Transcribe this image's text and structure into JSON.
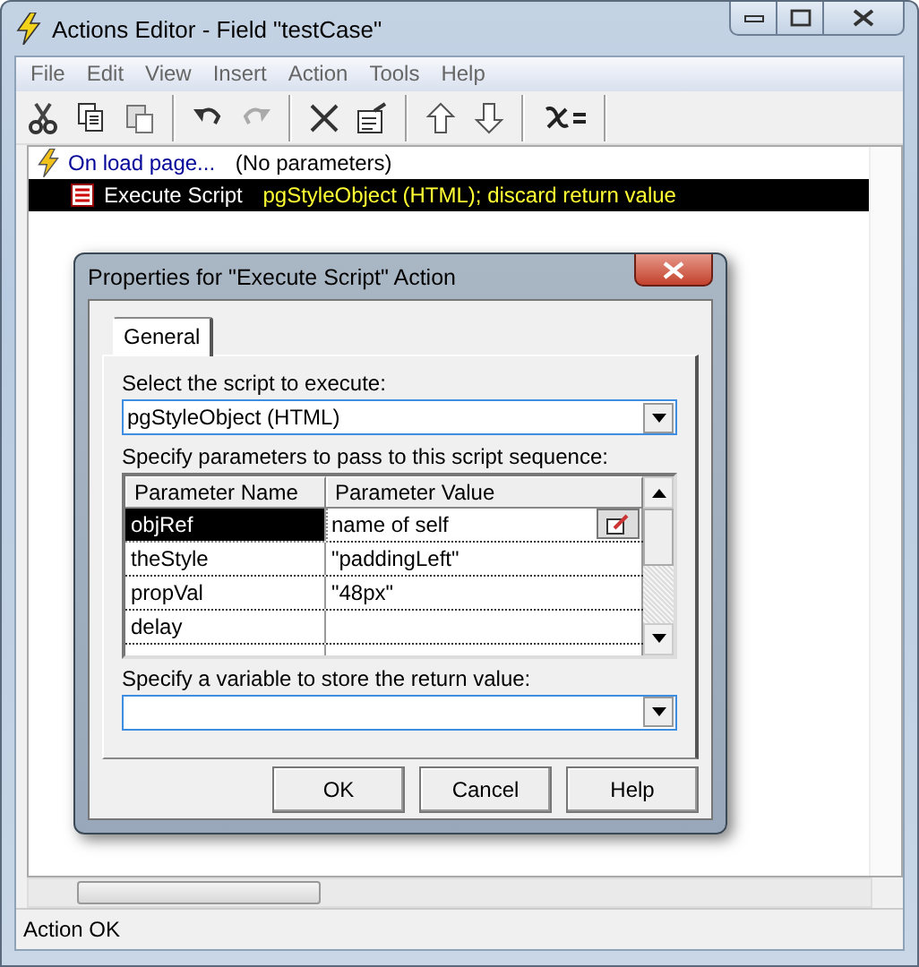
{
  "window": {
    "title": "Actions Editor - Field \"testCase\""
  },
  "menu": [
    "File",
    "Edit",
    "View",
    "Insert",
    "Action",
    "Tools",
    "Help"
  ],
  "actions": [
    {
      "kind": "event",
      "label": "On load page...",
      "detail": "(No parameters)",
      "selected": false,
      "children": [
        {
          "kind": "script",
          "label": "Execute Script",
          "detail": "pgStyleObject (HTML); discard return value",
          "selected": true
        }
      ]
    }
  ],
  "dialog": {
    "title": "Properties for \"Execute Script\" Action",
    "tabs": [
      {
        "label": "General",
        "selected": true
      }
    ],
    "script_label": "Select the script to execute:",
    "script_value": "pgStyleObject (HTML)",
    "params_label": "Specify parameters to pass to this script sequence:",
    "columns": [
      "Parameter Name",
      "Parameter Value"
    ],
    "rows": [
      {
        "name": "objRef",
        "value": "name of self",
        "selected": true
      },
      {
        "name": "theStyle",
        "value": "\"paddingLeft\"",
        "selected": false
      },
      {
        "name": "propVal",
        "value": "\"48px\"",
        "selected": false
      },
      {
        "name": "delay",
        "value": "",
        "selected": false
      }
    ],
    "return_label": "Specify a variable to store the return value:",
    "buttons": [
      "OK",
      "Cancel",
      "Help"
    ]
  },
  "status_bar": "Action OK"
}
